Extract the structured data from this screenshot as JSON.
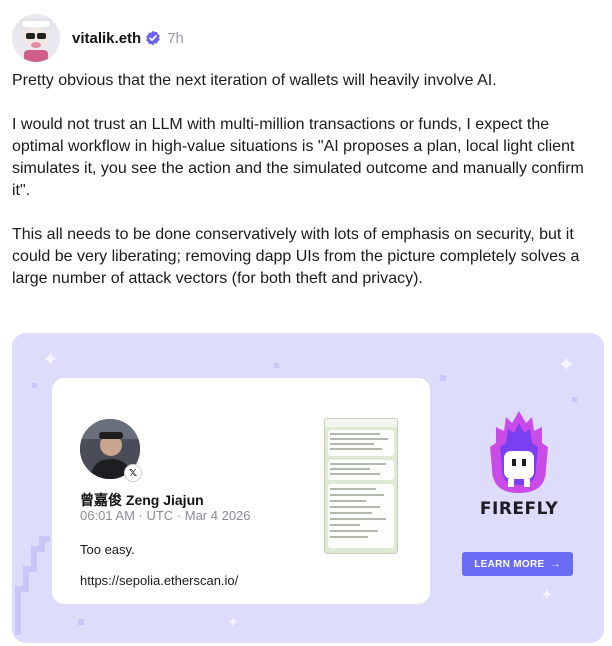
{
  "post": {
    "author": "vitalik.eth",
    "time": "7h",
    "paragraphs": [
      "Pretty obvious that the next iteration of wallets will heavily involve AI.",
      "I would not trust an LLM with multi-million transactions or funds, I expect the optimal workflow in high-value situations is \"AI proposes a plan, local light client simulates it, you see the action and the simulated outcome and manually confirm it\".",
      "This all needs to be done conservatively with lots of emphasis on security, but it could be very liberating; removing dapp UIs from the picture completely solves a large number of attack vectors (for both theft and privacy)."
    ]
  },
  "embed": {
    "tweet": {
      "name": "曾嘉俊 Zeng Jiajun",
      "meta": "06:01 AM · UTC · Mar 4 2026",
      "text": "Too easy.",
      "link": "https://sepolia.etherscan.io/"
    },
    "brand": "FIREFLY",
    "cta_label": "LEARN MORE",
    "cta_arrow": "→"
  },
  "icons": {
    "verified": "verified-badge-icon",
    "x_logo": "x-logo-icon"
  },
  "colors": {
    "verified": "#6c63f2",
    "embed_bg": "#dedcfb",
    "cta": "#6b6cf6"
  }
}
